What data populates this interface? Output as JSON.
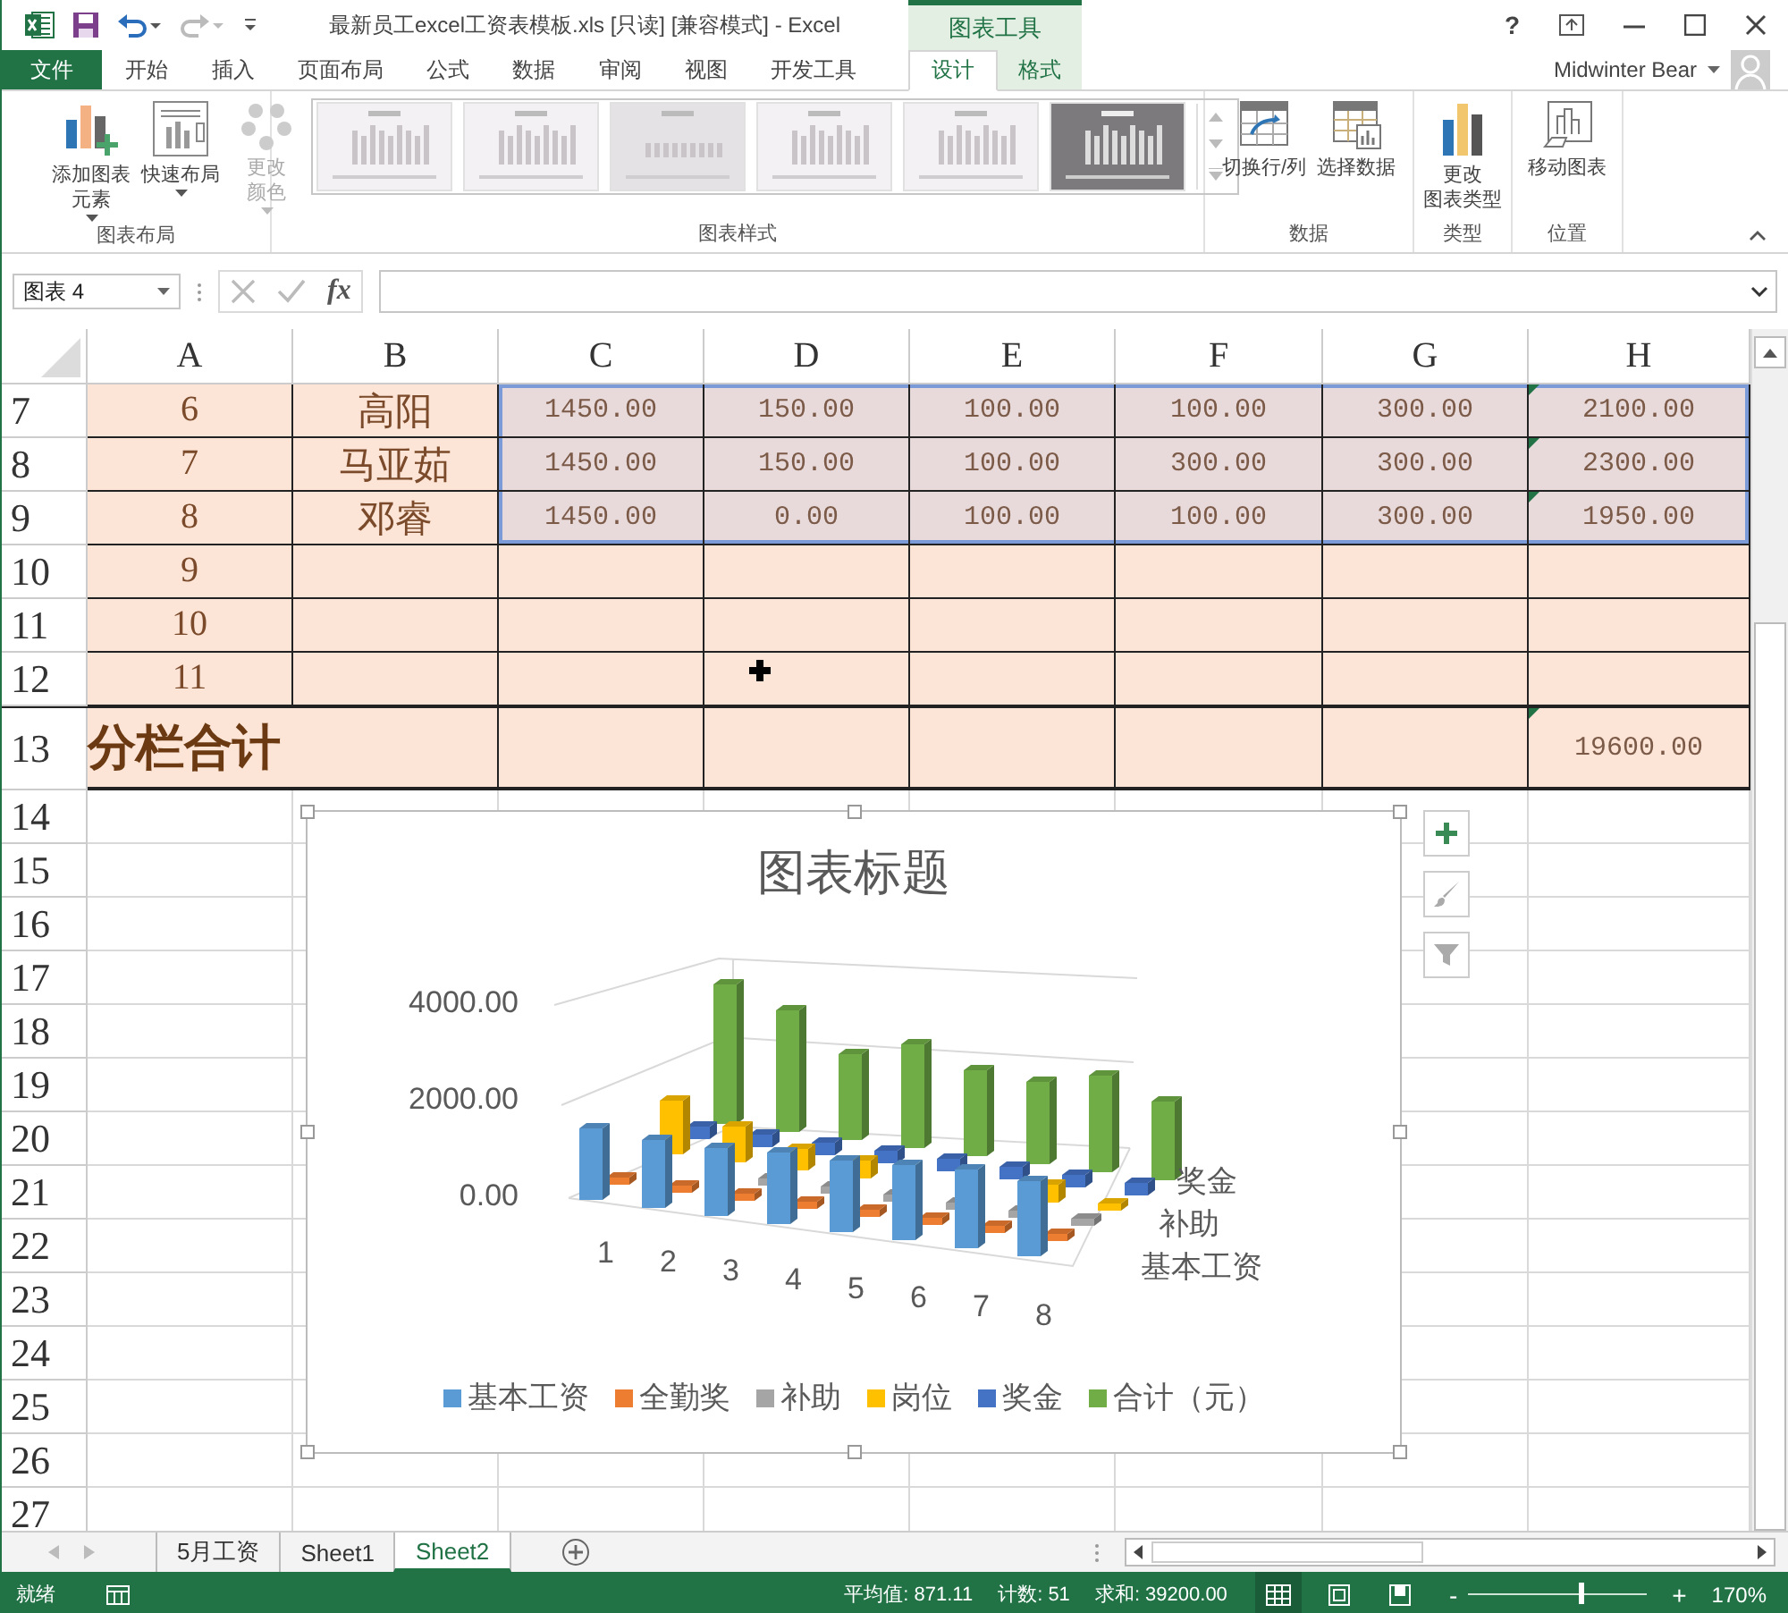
{
  "window": {
    "title": "最新员工excel工资表模板.xls  [只读]  [兼容模式] - Excel",
    "context_label": "图表工具",
    "help": "?",
    "user": "Midwinter Bear"
  },
  "tabs": [
    {
      "label": "文件",
      "kind": "file",
      "selected": false
    },
    {
      "label": "开始",
      "kind": "normal",
      "selected": false
    },
    {
      "label": "插入",
      "kind": "normal",
      "selected": false
    },
    {
      "label": "页面布局",
      "kind": "normal",
      "selected": false
    },
    {
      "label": "公式",
      "kind": "normal",
      "selected": false
    },
    {
      "label": "数据",
      "kind": "normal",
      "selected": false
    },
    {
      "label": "审阅",
      "kind": "normal",
      "selected": false
    },
    {
      "label": "视图",
      "kind": "normal",
      "selected": false
    },
    {
      "label": "开发工具",
      "kind": "normal",
      "selected": false
    },
    {
      "label": "设计",
      "kind": "context",
      "selected": true
    },
    {
      "label": "格式",
      "kind": "context",
      "selected": false
    }
  ],
  "ribbon": [
    {
      "label": "图表布局",
      "buttons": [
        {
          "kind": "add-element",
          "lines": [
            "添加图表",
            "元素"
          ],
          "dropdown": true,
          "disabled": false
        },
        {
          "kind": "quick-layout",
          "lines": [
            "快速布局"
          ],
          "dropdown": true,
          "disabled": false
        }
      ]
    },
    {
      "label": "图表样式",
      "buttons": [
        {
          "kind": "change-colors",
          "lines": [
            "更改",
            "颜色"
          ],
          "dropdown": true,
          "disabled": true
        }
      ],
      "gallery": [
        {
          "kind": "light"
        },
        {
          "kind": "light"
        },
        {
          "kind": "shaded"
        },
        {
          "kind": "light"
        },
        {
          "kind": "light"
        },
        {
          "kind": "dark"
        }
      ]
    },
    {
      "label": "数据",
      "buttons": [
        {
          "kind": "switch",
          "lines": [
            "切换行/列"
          ],
          "dropdown": false,
          "disabled": false
        },
        {
          "kind": "select-data",
          "lines": [
            "选择数据"
          ],
          "dropdown": false,
          "disabled": false
        }
      ]
    },
    {
      "label": "类型",
      "buttons": [
        {
          "kind": "change-type",
          "lines": [
            "更改",
            "图表类型"
          ],
          "dropdown": false,
          "disabled": false
        }
      ]
    },
    {
      "label": "位置",
      "buttons": [
        {
          "kind": "move",
          "lines": [
            "移动图表"
          ],
          "dropdown": false,
          "disabled": false
        }
      ]
    }
  ],
  "formula_bar": {
    "name_box": "图表 4",
    "fx": "fx"
  },
  "sheet": {
    "columns": [
      "A",
      "B",
      "C",
      "D",
      "E",
      "F",
      "G",
      "H"
    ],
    "rows": [
      {
        "number": "7",
        "kind": "data",
        "selected": true,
        "flag": true,
        "cells": [
          "6",
          "高阳",
          "1450.00",
          "150.00",
          "100.00",
          "100.00",
          "300.00",
          "2100.00"
        ]
      },
      {
        "number": "8",
        "kind": "data",
        "selected": true,
        "flag": true,
        "cells": [
          "7",
          "马亚茹",
          "1450.00",
          "150.00",
          "100.00",
          "300.00",
          "300.00",
          "2300.00"
        ]
      },
      {
        "number": "9",
        "kind": "data",
        "selected": true,
        "flag": true,
        "cells": [
          "8",
          "邓睿",
          "1450.00",
          "0.00",
          "100.00",
          "100.00",
          "300.00",
          "1950.00"
        ]
      },
      {
        "number": "10",
        "kind": "data",
        "selected": false,
        "flag": false,
        "cells": [
          "9",
          null,
          null,
          null,
          null,
          null,
          null,
          null
        ]
      },
      {
        "number": "11",
        "kind": "data",
        "selected": false,
        "flag": false,
        "cells": [
          "10",
          null,
          null,
          null,
          null,
          null,
          null,
          null
        ]
      },
      {
        "number": "12",
        "kind": "data",
        "selected": false,
        "flag": false,
        "cells": [
          "11",
          null,
          null,
          null,
          null,
          null,
          null,
          null
        ]
      },
      {
        "number": "13",
        "kind": "total",
        "flag": true,
        "label": "分栏合计",
        "total": "19600.00"
      },
      {
        "number": "14",
        "kind": "blank"
      },
      {
        "number": "15",
        "kind": "blank"
      },
      {
        "number": "16",
        "kind": "blank"
      },
      {
        "number": "17",
        "kind": "blank"
      },
      {
        "number": "18",
        "kind": "blank"
      },
      {
        "number": "19",
        "kind": "blank"
      },
      {
        "number": "20",
        "kind": "blank"
      },
      {
        "number": "21",
        "kind": "blank"
      },
      {
        "number": "22",
        "kind": "blank"
      },
      {
        "number": "23",
        "kind": "blank"
      },
      {
        "number": "24",
        "kind": "blank"
      },
      {
        "number": "25",
        "kind": "blank"
      },
      {
        "number": "26",
        "kind": "blank"
      },
      {
        "number": "27",
        "kind": "blank"
      }
    ]
  },
  "chart": {
    "title": "图表标题",
    "y_labels": [
      "4000.00",
      "2000.00",
      "0.00"
    ],
    "x_labels": [
      "1",
      "2",
      "3",
      "4",
      "5",
      "6",
      "7",
      "8"
    ],
    "depth_labels": [
      "奖金",
      "补助",
      "基本工资"
    ],
    "legend": [
      {
        "label": "基本工资",
        "color": "#5b9bd5"
      },
      {
        "label": "全勤奖",
        "color": "#ed7d31"
      },
      {
        "label": "补助",
        "color": "#a5a5a5"
      },
      {
        "label": "岗位",
        "color": "#ffc000"
      },
      {
        "label": "奖金",
        "color": "#4472c4"
      },
      {
        "label": "合计（元）",
        "color": "#70ad47"
      }
    ]
  },
  "sheet_tabs": [
    {
      "label": "5月工资",
      "selected": false
    },
    {
      "label": "Sheet1",
      "selected": false
    },
    {
      "label": "Sheet2",
      "selected": true
    }
  ],
  "status_bar": {
    "mode": "就绪",
    "average": "平均值: 871.11",
    "count": "计数: 51",
    "sum": "求和: 39200.00",
    "views": [
      {
        "kind": "normal",
        "selected": true
      },
      {
        "kind": "layout",
        "selected": false
      },
      {
        "kind": "break",
        "selected": false
      }
    ],
    "zoom_out": "-",
    "zoom_in": "+",
    "zoom": {
      "level": 0.62,
      "label": "170%"
    }
  }
}
